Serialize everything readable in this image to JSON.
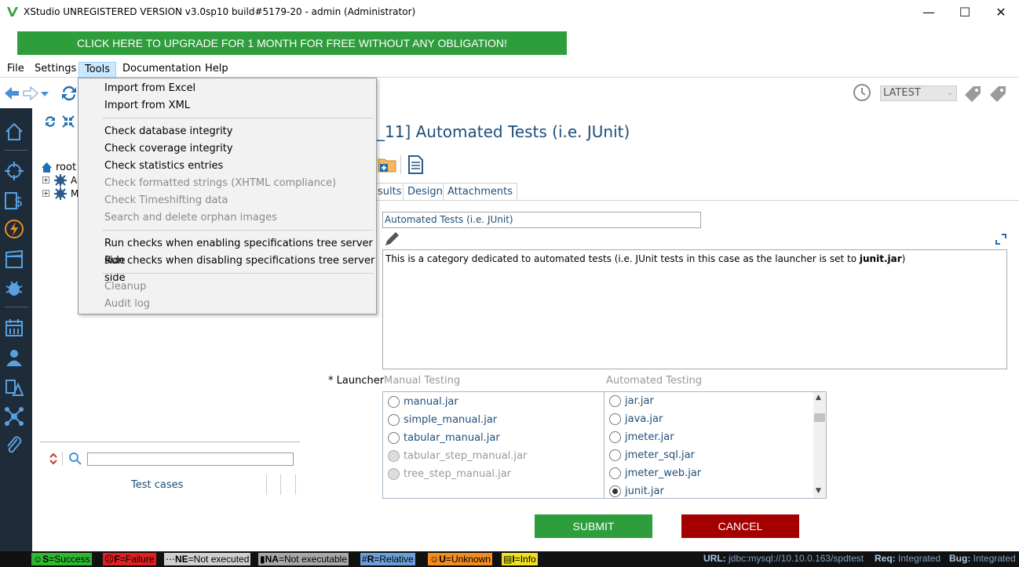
{
  "window": {
    "title": "XStudio UNREGISTERED VERSION v3.0sp10 build#5179-20 - admin (Administrator)",
    "minimize": "—",
    "maximize": "☐",
    "close": "✕"
  },
  "upgrade_banner": "CLICK HERE TO UPGRADE FOR 1 MONTH FOR FREE WITHOUT ANY OBLIGATION!",
  "menu": {
    "items": [
      "File",
      "Settings",
      "Tools",
      "Documentation",
      "Help"
    ],
    "active": "Tools"
  },
  "tools_menu": {
    "items": [
      {
        "label": "Import from Excel",
        "enabled": true
      },
      {
        "label": "Import from XML",
        "enabled": true
      },
      {
        "label": "Check database integrity",
        "enabled": true
      },
      {
        "label": "Check coverage integrity",
        "enabled": true
      },
      {
        "label": "Check statistics entries",
        "enabled": true
      },
      {
        "label": "Check formatted strings (XHTML compliance)",
        "enabled": false
      },
      {
        "label": "Check Timeshifting data",
        "enabled": false
      },
      {
        "label": "Search and delete orphan images",
        "enabled": false
      },
      {
        "label": "Run checks when enabling specifications tree server side",
        "enabled": true
      },
      {
        "label": "Run checks when disabling specifications tree server side",
        "enabled": true
      },
      {
        "label": "Cleanup",
        "enabled": false
      },
      {
        "label": "Audit log",
        "enabled": false
      }
    ]
  },
  "toolbar": {
    "version_select": "LATEST"
  },
  "tree": {
    "root_label": "root",
    "child1_label": "A",
    "child2_label": "M",
    "search_value": "",
    "footer_label": "Test cases"
  },
  "main": {
    "heading": "_11] Automated Tests (i.e. JUnit)",
    "tabs": [
      "sults",
      "Design",
      "Attachments"
    ],
    "name_value": "Automated Tests (i.e. JUnit)",
    "description_text": "This is a category dedicated to automated tests (i.e. JUnit tests in this case as the launcher is set to ",
    "description_bold": "junit.jar",
    "description_end": ")",
    "launcher_label": "* Launcher",
    "manual_header": "Manual Testing",
    "automated_header": "Automated Testing",
    "manual_launchers": [
      {
        "label": "manual.jar",
        "enabled": true
      },
      {
        "label": "simple_manual.jar",
        "enabled": true
      },
      {
        "label": "tabular_manual.jar",
        "enabled": true
      },
      {
        "label": "tabular_step_manual.jar",
        "enabled": false
      },
      {
        "label": "tree_step_manual.jar",
        "enabled": false
      }
    ],
    "automated_launchers": [
      {
        "label": "jar.jar",
        "selected": false
      },
      {
        "label": "java.jar",
        "selected": false
      },
      {
        "label": "jmeter.jar",
        "selected": false
      },
      {
        "label": "jmeter_sql.jar",
        "selected": false
      },
      {
        "label": "jmeter_web.jar",
        "selected": false
      },
      {
        "label": "junit.jar",
        "selected": true
      }
    ],
    "submit": "SUBMIT",
    "cancel": "CANCEL"
  },
  "status": {
    "legend": [
      {
        "code": "S",
        "text": "=Success",
        "bg": "#2fb82f",
        "fg": "#000"
      },
      {
        "code": "F",
        "text": "=Failure",
        "bg": "#e02020",
        "fg": "#000"
      },
      {
        "code": "NE",
        "text": "=Not executed",
        "bg": "#d0d0d0",
        "fg": "#000"
      },
      {
        "code": "NA",
        "text": "=Not executable",
        "bg": "#a8a8a8",
        "fg": "#000"
      },
      {
        "code": "R",
        "text": "=Relative",
        "bg": "#6a9fd8",
        "fg": "#000"
      },
      {
        "code": "U",
        "text": "=Unknown",
        "bg": "#f28c1e",
        "fg": "#000"
      },
      {
        "code": "I",
        "text": "=Info",
        "bg": "#f0e020",
        "fg": "#000"
      }
    ],
    "url_label": "URL:",
    "url_value": "jdbc:mysql://10.10.0.163/spdtest",
    "req_label": "Req:",
    "req_value": "Integrated",
    "bug_label": "Bug:",
    "bug_value": "Integrated"
  },
  "colors": {
    "accent": "#1f4e79",
    "submit": "#2e9e3c",
    "cancel": "#a50000",
    "sidebar": "#1e2b38"
  }
}
